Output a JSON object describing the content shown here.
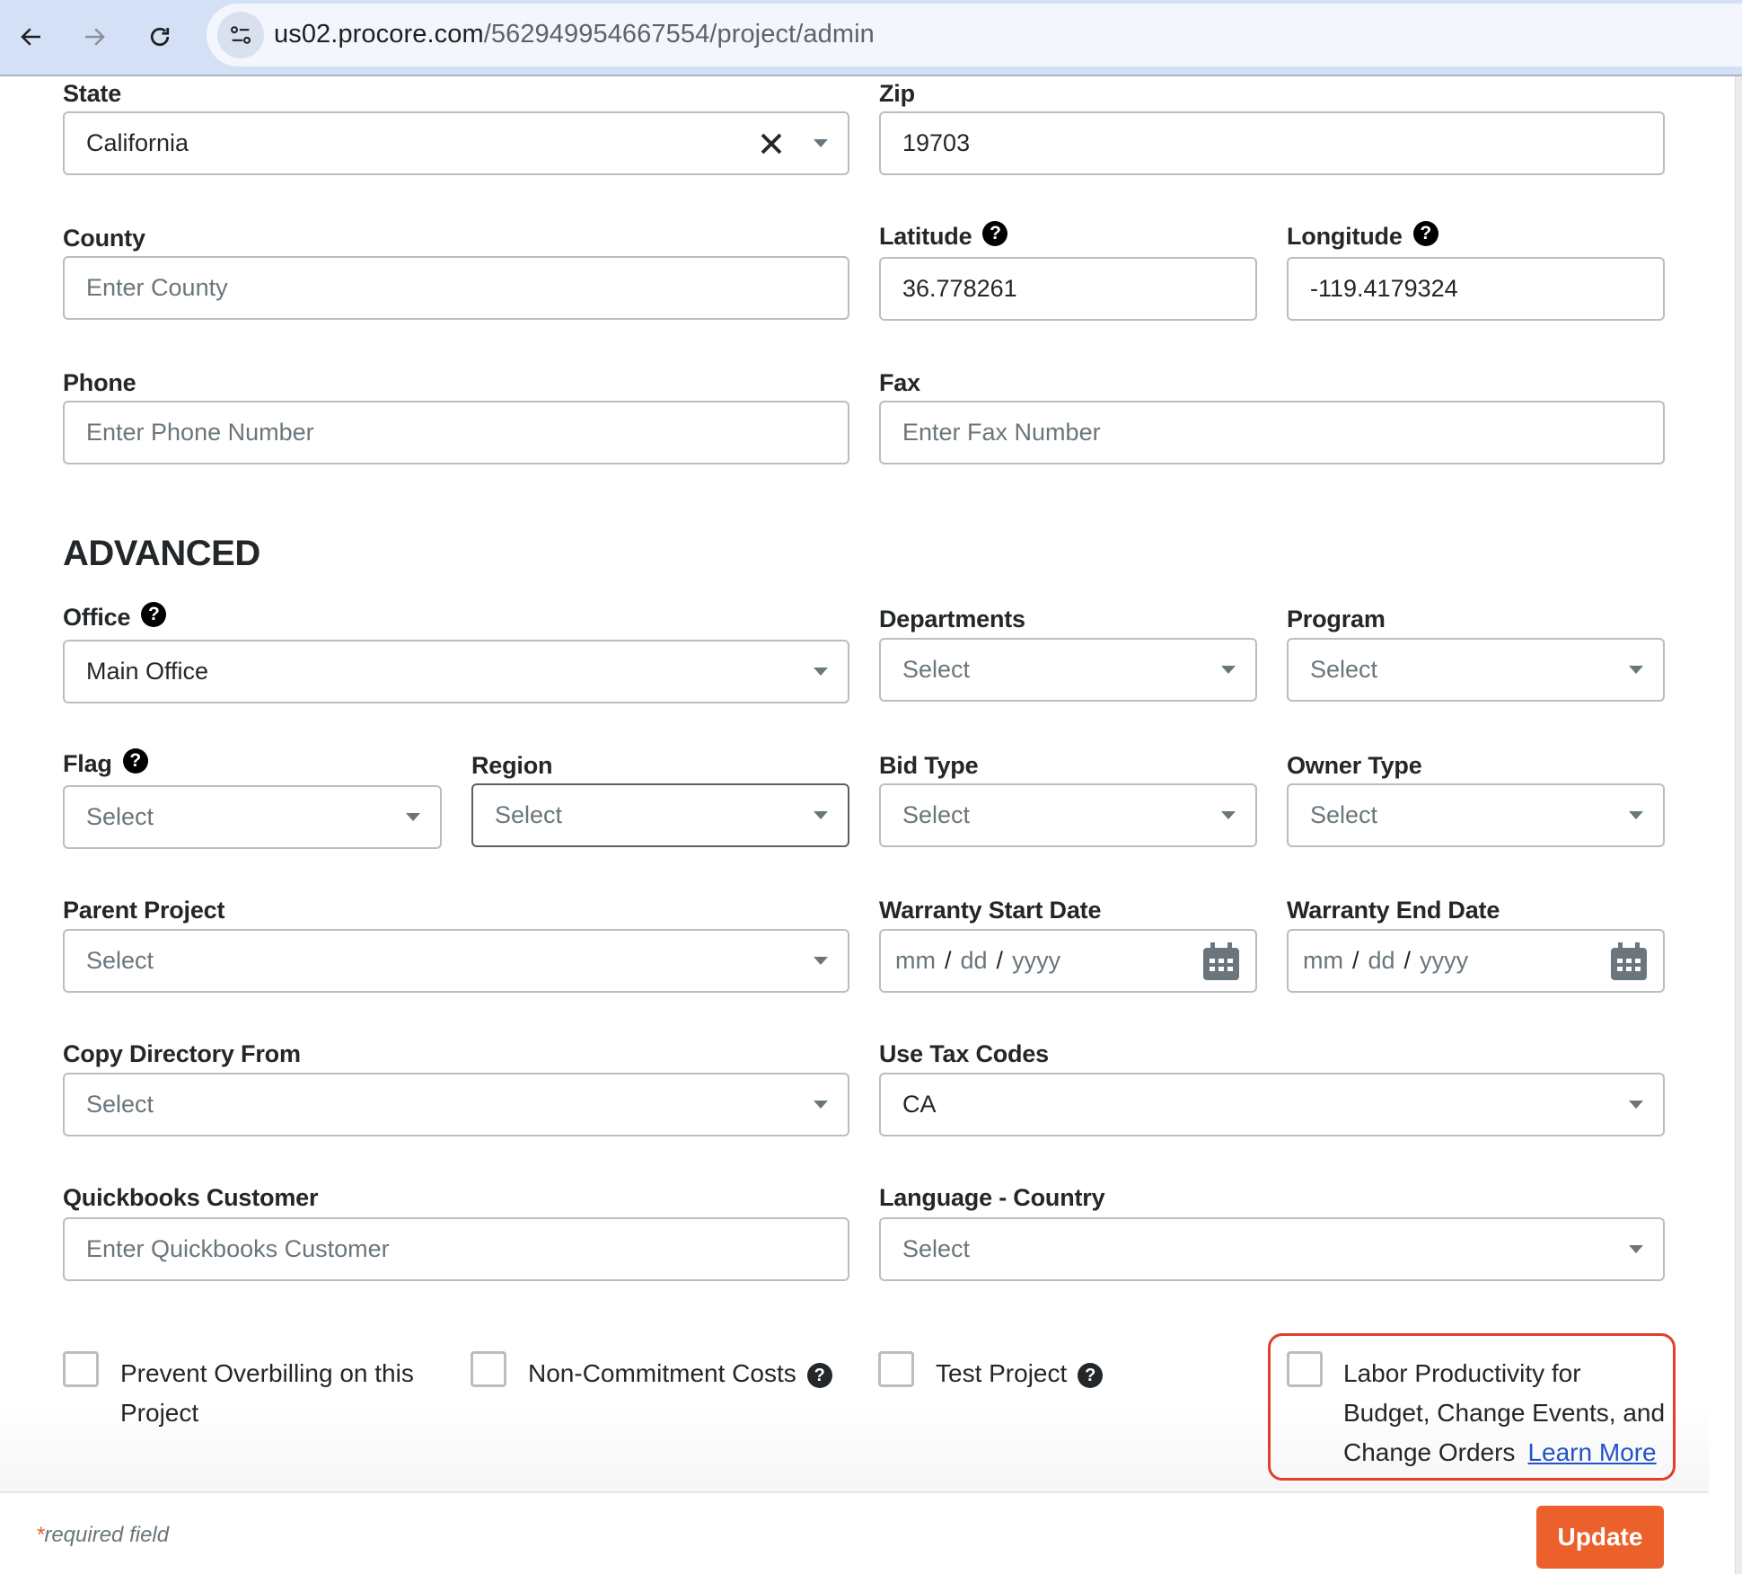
{
  "browser": {
    "url_host": "us02.procore.com",
    "url_path": "/562949954667554/project/admin"
  },
  "form": {
    "state": {
      "label": "State",
      "value": "California"
    },
    "zip": {
      "label": "Zip",
      "value": "19703"
    },
    "county": {
      "label": "County",
      "placeholder": "Enter County"
    },
    "latitude": {
      "label": "Latitude",
      "value": "36.778261"
    },
    "longitude": {
      "label": "Longitude",
      "value": "-119.4179324"
    },
    "phone": {
      "label": "Phone",
      "placeholder": "Enter Phone Number"
    },
    "fax": {
      "label": "Fax",
      "placeholder": "Enter Fax Number"
    }
  },
  "advanced": {
    "title": "ADVANCED",
    "office": {
      "label": "Office",
      "value": "Main Office"
    },
    "departments": {
      "label": "Departments",
      "placeholder": "Select"
    },
    "program": {
      "label": "Program",
      "placeholder": "Select"
    },
    "flag": {
      "label": "Flag",
      "placeholder": "Select"
    },
    "region": {
      "label": "Region",
      "placeholder": "Select"
    },
    "bid_type": {
      "label": "Bid Type",
      "placeholder": "Select"
    },
    "owner_type": {
      "label": "Owner Type",
      "placeholder": "Select"
    },
    "parent_project": {
      "label": "Parent Project",
      "placeholder": "Select"
    },
    "warranty_start": {
      "label": "Warranty Start Date",
      "mm": "mm",
      "dd": "dd",
      "yyyy": "yyyy",
      "sep": "/"
    },
    "warranty_end": {
      "label": "Warranty End Date",
      "mm": "mm",
      "dd": "dd",
      "yyyy": "yyyy",
      "sep": "/"
    },
    "copy_directory": {
      "label": "Copy Directory From",
      "placeholder": "Select"
    },
    "use_tax_codes": {
      "label": "Use Tax Codes",
      "value": "CA"
    },
    "quickbooks": {
      "label": "Quickbooks Customer",
      "placeholder": "Enter Quickbooks Customer"
    },
    "language_country": {
      "label": "Language - Country",
      "placeholder": "Select"
    },
    "help_glyph": "?"
  },
  "checkboxes": {
    "prevent_overbilling": {
      "label_line1": "Prevent Overbilling on this",
      "label_line2": "Project",
      "checked": false
    },
    "non_commitment": {
      "label": "Non-Commitment Costs",
      "checked": false
    },
    "test_project": {
      "label": "Test Project",
      "checked": false
    },
    "labor_productivity": {
      "line1": "Labor Productivity for",
      "line2": "Budget, Change Events, and",
      "line3": "Change Orders",
      "link": "Learn More",
      "checked": false
    }
  },
  "footer": {
    "required_star": "*",
    "required_text": "required field",
    "update_label": "Update"
  },
  "colors": {
    "accent": "#ec602c",
    "highlight": "#e23f2a",
    "link": "#2253c8"
  }
}
